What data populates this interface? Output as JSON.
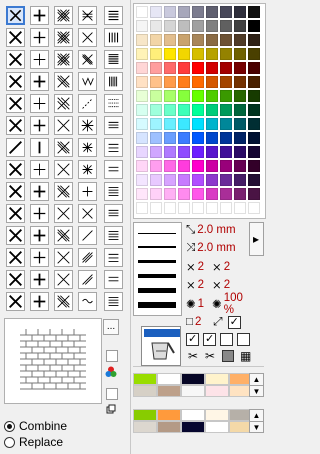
{
  "props": {
    "width": "2.0 mm",
    "offset": "2.0 mm",
    "cross_a": "2",
    "cross_b": "2",
    "cross_c": "2",
    "cross_d": "2",
    "spray_a": "1",
    "spray_b": "100 %",
    "square_val": "2"
  },
  "combine": {
    "label": "Combine",
    "selected": true
  },
  "replace": {
    "label": "Replace",
    "selected": false
  },
  "more_button": "...",
  "expand_button": "▸",
  "colors": {
    "accent": "#3b79d1",
    "value_red": "#b00000"
  }
}
